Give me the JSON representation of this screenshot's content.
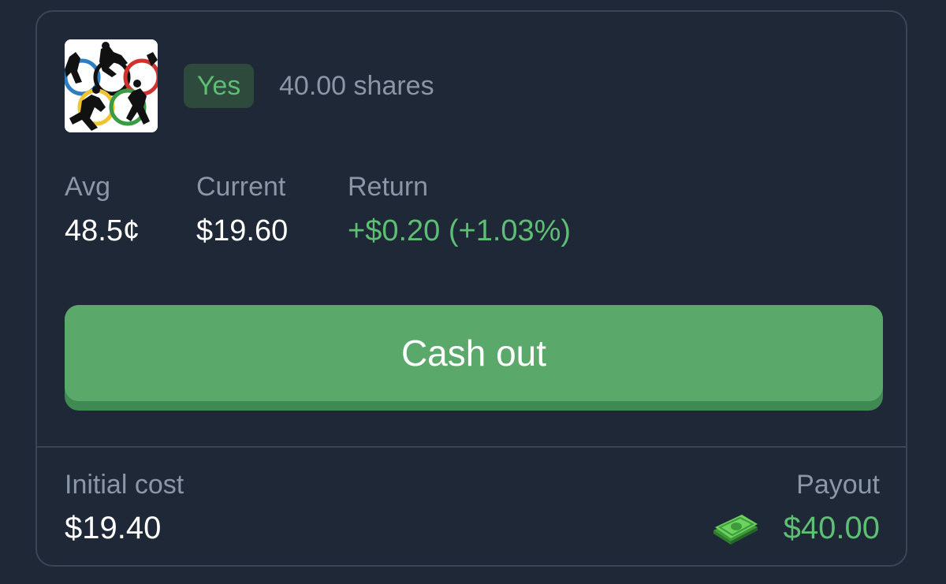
{
  "position": {
    "thumbnail_icon": "olympic-rings-icon",
    "outcome": "Yes",
    "shares": "40.00 shares"
  },
  "stats": {
    "avg": {
      "label": "Avg",
      "value": "48.5¢"
    },
    "current": {
      "label": "Current",
      "value": "$19.60"
    },
    "return": {
      "label": "Return",
      "value": "+$0.20 (+1.03%)"
    }
  },
  "actions": {
    "cash_out_label": "Cash out"
  },
  "footer": {
    "initial_cost_label": "Initial cost",
    "initial_cost_value": "$19.40",
    "payout_label": "Payout",
    "payout_icon": "money-icon",
    "payout_value": "$40.00"
  },
  "colors": {
    "background": "#1f2836",
    "positive": "#5dbf74",
    "button": "#5ba86b",
    "muted_text": "#8b96a6"
  }
}
